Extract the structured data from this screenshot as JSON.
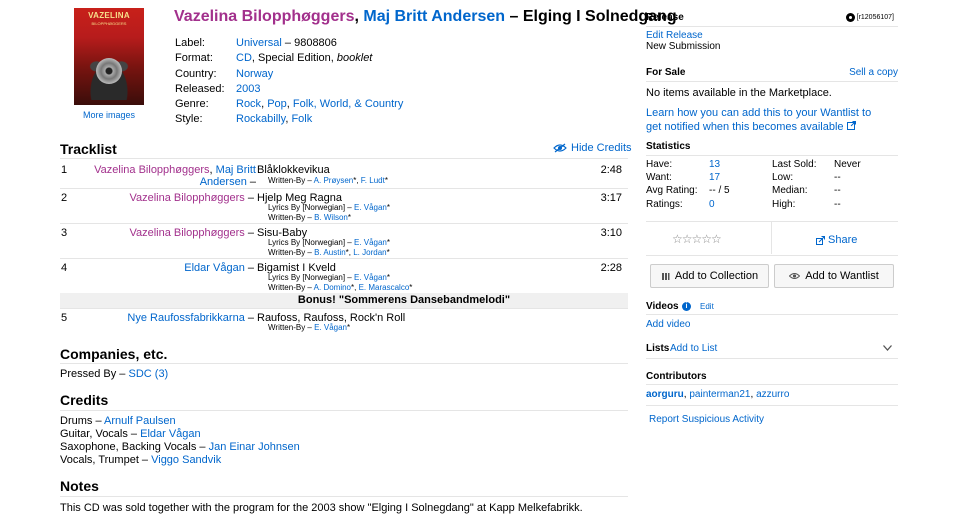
{
  "cover": {
    "line1": "VAZELINA",
    "line2": "BILOPPHØGGERS"
  },
  "more_images": "More images",
  "title": {
    "artist1": "Vazelina Bilopphøggers",
    "sep1": ", ",
    "artist2": "Maj Britt Andersen",
    "dash": " – ",
    "album": "Elging I Solnedgang"
  },
  "info": {
    "label_lbl": "Label:",
    "label": "Universal",
    "catno": " – 9808806",
    "format_lbl": "Format:",
    "format_cd": "CD",
    "format_rest": ", Special Edition, ",
    "format_italic": "booklet",
    "country_lbl": "Country:",
    "country": "Norway",
    "released_lbl": "Released:",
    "released": "2003",
    "genre_lbl": "Genre:",
    "genre1": "Rock",
    "genre2": "Pop",
    "genre3": "Folk, World, & Country",
    "style_lbl": "Style:",
    "style1": "Rockabilly",
    "style2": "Folk"
  },
  "tracklist": {
    "title": "Tracklist",
    "hide_credits": "Hide Credits",
    "tracks": [
      {
        "pos": "1",
        "artist_a": "Vazelina Bilopphøggers",
        "artist_b": "Maj Britt",
        "artist_c": "Andersen",
        "title": "Blåklokkevikua",
        "duration": "2:48",
        "credits": [
          [
            "Written-By – ",
            "A. Prøysen",
            "*, ",
            "F. Ludt",
            "*"
          ]
        ]
      },
      {
        "pos": "2",
        "artist": "Vazelina Bilopphøggers",
        "title": "Hjelp Meg Ragna",
        "duration": "3:17",
        "credits": [
          [
            "Lyrics By [Norwegian] – ",
            "E. Vågan",
            "*"
          ],
          [
            "Written-By – ",
            "B. Wilson",
            "*"
          ]
        ]
      },
      {
        "pos": "3",
        "artist": "Vazelina Bilopphøggers",
        "title": "Sisu-Baby",
        "duration": "3:10",
        "credits": [
          [
            "Lyrics By [Norwegian] – ",
            "E. Vågan",
            "*"
          ],
          [
            "Written-By – ",
            "B. Austin",
            "*, ",
            "L. Jordan",
            "*"
          ]
        ]
      },
      {
        "pos": "4",
        "artist": "Eldar Vågan",
        "title": "Bigamist I Kveld",
        "duration": "2:28",
        "credits": [
          [
            "Lyrics By [Norwegian] – ",
            "E. Vågan",
            "*"
          ],
          [
            "Written-By – ",
            "A. Domino",
            "*, ",
            "E. Marascalco",
            "*"
          ]
        ]
      },
      {
        "pos": "5",
        "artist": "Nye Raufossfabrikkarna",
        "title": "Raufoss, Raufoss, Rock'n Roll",
        "duration": "",
        "credits": [
          [
            "Written-By – ",
            "E. Vågan",
            "*"
          ]
        ]
      }
    ],
    "bonus_heading": "Bonus! \"Sommerens Dansebandmelodi\""
  },
  "companies": {
    "title": "Companies, etc.",
    "pressed_by": "Pressed By – ",
    "pressed_link": "SDC",
    "pressed_count": " (3)"
  },
  "credits": {
    "title": "Credits",
    "rows": [
      {
        "role": "Drums – ",
        "name": "Arnulf Paulsen"
      },
      {
        "role": "Guitar, Vocals – ",
        "name": "Eldar Vågan"
      },
      {
        "role": "Saxophone, Backing Vocals – ",
        "name": "Jan Einar Johnsen"
      },
      {
        "role": "Vocals, Trumpet – ",
        "name": "Viggo Sandvik"
      }
    ]
  },
  "notes": {
    "title": "Notes",
    "text": "This CD was sold together with the program for the 2003 show \"Elging I Solnegdang\" at Kapp Melkefabrikk."
  },
  "sidebar": {
    "release_title": "Release",
    "release_id": "[r12056107]",
    "edit_release": "Edit Release",
    "status": "New Submission",
    "for_sale_title": "For Sale",
    "sell_copy": "Sell a copy",
    "no_items": "No items available in the Marketplace.",
    "wantlist_note": "Learn how you can add this to your Wantlist to get notified when this becomes available",
    "statistics_title": "Statistics",
    "have_lbl": "Have:",
    "have": "13",
    "want_lbl": "Want:",
    "want": "17",
    "avg_lbl": "Avg Rating:",
    "avg": "-- / 5",
    "ratings_lbl": "Ratings:",
    "ratings": "0",
    "last_sold_lbl": "Last Sold:",
    "last_sold": "Never",
    "low_lbl": "Low:",
    "low": "--",
    "median_lbl": "Median:",
    "median": "--",
    "high_lbl": "High:",
    "high": "--",
    "stars": "☆☆☆☆☆",
    "share": "Share",
    "add_collection": "Add to Collection",
    "add_wantlist": "Add to Wantlist",
    "videos_title": "Videos",
    "videos_edit": "Edit",
    "add_video": "Add video",
    "lists_title": "Lists",
    "add_to_list": "Add to List",
    "contributors_title": "Contributors",
    "contrib1": "aorguru",
    "contrib2": "painterman21",
    "contrib3": "azzurro",
    "report": "Report Suspicious Activity"
  },
  "colors": {
    "link": "#0066cc",
    "artist": "#a2308c"
  }
}
